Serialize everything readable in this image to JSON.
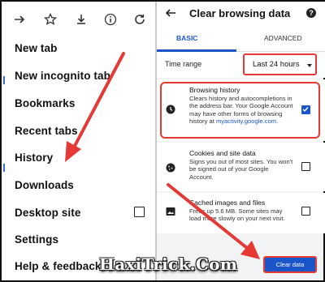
{
  "menu": {
    "items": [
      "New tab",
      "New incognito tab",
      "Bookmarks",
      "Recent tabs",
      "History",
      "Downloads",
      "Desktop site",
      "Settings",
      "Help & feedback"
    ]
  },
  "toolbar_icons": [
    "forward-icon",
    "star-icon",
    "download-icon",
    "info-icon",
    "reload-icon"
  ],
  "panel": {
    "title": "Clear browsing data",
    "help": "?",
    "tabs": {
      "basic": "BASIC",
      "advanced": "ADVANCED"
    },
    "time_range": {
      "label": "Time range",
      "value": "Last 24 hours"
    },
    "history": {
      "title": "Browsing history",
      "desc": "Clears history and autocompletions in the address bar. Your Google Account may have other forms of browsing history at",
      "link": "myactivity.google.com."
    },
    "cookies": {
      "title": "Cookies and site data",
      "desc": "Signs you out of most sites. You won't be signed out of your Google Account."
    },
    "cache": {
      "title": "Cached images and files",
      "desc": "Frees up 5.6 MB. Some sites may load more slowly on your next visit."
    },
    "clear_button": "Clear data"
  },
  "watermark": "HaxiTrick.Com",
  "colors": {
    "accent": "#1a56c9",
    "highlight": "#e53935"
  }
}
